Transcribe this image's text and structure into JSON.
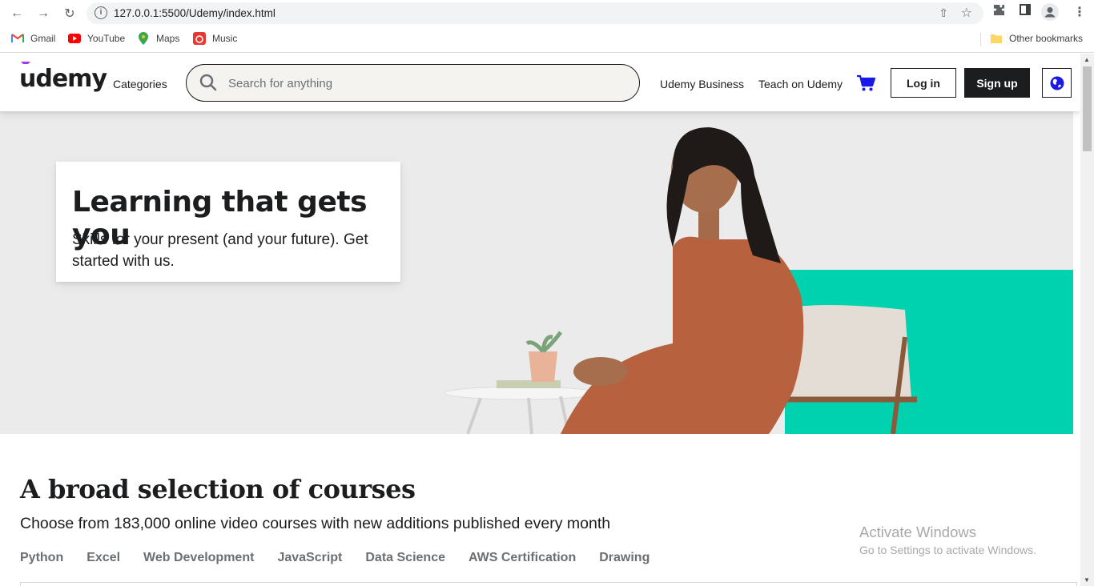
{
  "browser": {
    "url": "127.0.0.1:5500/Udemy/index.html",
    "bookmarks": [
      {
        "label": "Gmail",
        "icon": "gmail-icon"
      },
      {
        "label": "YouTube",
        "icon": "youtube-icon"
      },
      {
        "label": "Maps",
        "icon": "maps-icon"
      },
      {
        "label": "Music",
        "icon": "music-icon"
      }
    ],
    "other_bookmarks": "Other bookmarks"
  },
  "header": {
    "logo": "udemy",
    "categories": "Categories",
    "search_placeholder": "Search for anything",
    "business": "Udemy Business",
    "teach": "Teach on Udemy",
    "login": "Log in",
    "signup": "Sign up"
  },
  "hero": {
    "title": "Learning that gets you",
    "subtitle": "Skills for your present (and your future). Get started with us."
  },
  "courses": {
    "title": "A broad selection of courses",
    "subtitle": "Choose from 183,000 online video courses with new additions published every month",
    "tabs": [
      "Python",
      "Excel",
      "Web Development",
      "JavaScript",
      "Data Science",
      "AWS Certification",
      "Drawing"
    ]
  },
  "watermark": {
    "line1": "Activate Windows",
    "line2": "Go to Settings to activate Windows."
  },
  "colors": {
    "brand_purple": "#a435f0",
    "teal": "#00d1ae",
    "dark": "#1c1d1f",
    "hero_bg": "#ebebeb",
    "cart_blue": "#1a1ae6"
  }
}
